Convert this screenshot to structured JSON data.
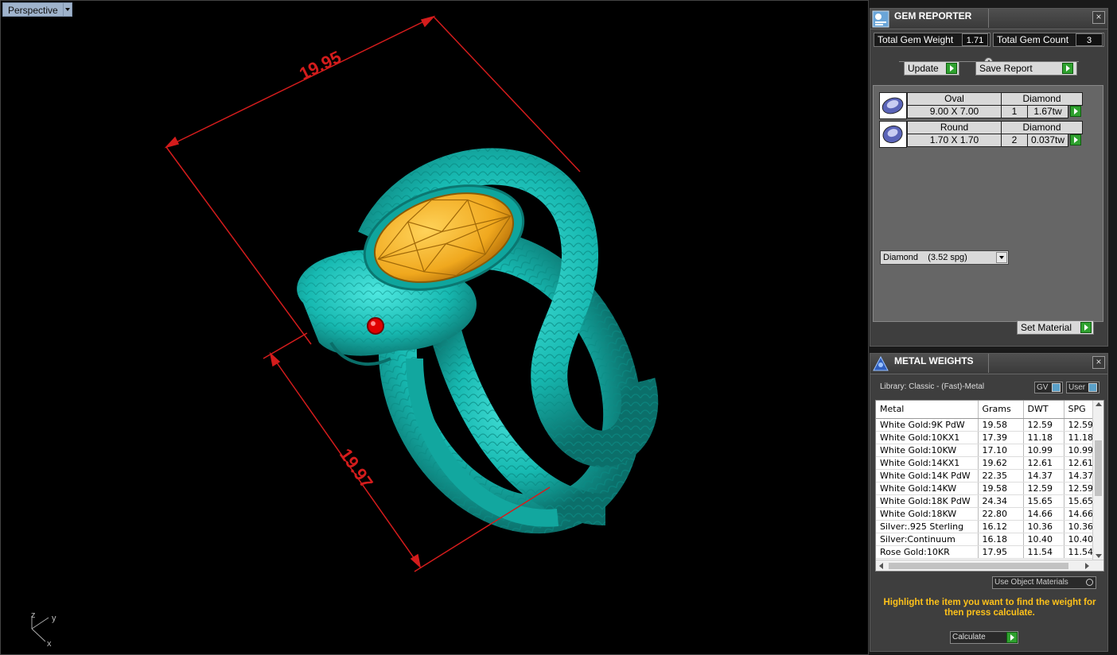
{
  "viewport": {
    "label": "Perspective",
    "dimension_top": "19.95",
    "dimension_left": "19.97",
    "axis_z": "z",
    "axis_y": "y",
    "axis_x": "x"
  },
  "gem_reporter": {
    "title": "GEM REPORTER",
    "total_weight_label": "Total Gem Weight",
    "total_weight_value": "1.71",
    "total_count_label": "Total Gem Count",
    "total_count_value": "3",
    "update_label": "Update",
    "save_report_label": "Save Report",
    "gems": [
      {
        "shape": "Oval",
        "material": "Diamond",
        "size": "9.00 X 7.00",
        "qty": "1",
        "weight": "1.67tw"
      },
      {
        "shape": "Round",
        "material": "Diamond",
        "size": "1.70 X 1.70",
        "qty": "2",
        "weight": "0.037tw"
      }
    ],
    "material_select": "Diamond    (3.52 spg)",
    "set_material_label": "Set Material"
  },
  "metal_weights": {
    "title": "METAL WEIGHTS",
    "library_label": "Library: Classic - (Fast)-Metal",
    "gv_label": "GV",
    "user_label": "User",
    "columns": [
      "Metal",
      "Grams",
      "DWT",
      "SPG"
    ],
    "rows": [
      [
        "White Gold:9K PdW",
        "19.58",
        "12.59",
        "12.59"
      ],
      [
        "White Gold:10KX1",
        "17.39",
        "11.18",
        "11.18"
      ],
      [
        "White Gold:10KW",
        "17.10",
        "10.99",
        "10.99"
      ],
      [
        "White Gold:14KX1",
        "19.62",
        "12.61",
        "12.61"
      ],
      [
        "White Gold:14K PdW",
        "22.35",
        "14.37",
        "14.37"
      ],
      [
        "White Gold:14KW",
        "19.58",
        "12.59",
        "12.59"
      ],
      [
        "White Gold:18K PdW",
        "24.34",
        "15.65",
        "15.65"
      ],
      [
        "White Gold:18KW",
        "22.80",
        "14.66",
        "14.66"
      ],
      [
        "Silver:.925 Sterling",
        "16.12",
        "10.36",
        "10.36"
      ],
      [
        "Silver:Continuum",
        "16.18",
        "10.40",
        "10.40"
      ],
      [
        "Rose Gold:10KR",
        "17.95",
        "11.54",
        "11.54"
      ]
    ],
    "use_object_materials_label": "Use Object Materials",
    "hint": "Highlight the item you want to find the weight for then press calculate.",
    "calculate_label": "Calculate"
  },
  "colors": {
    "ring": "#18c9bf",
    "gem": "#f0a81e",
    "dimension": "#d41c1c",
    "go_button": "#2fa12f",
    "hint_text": "#ffc21a"
  }
}
